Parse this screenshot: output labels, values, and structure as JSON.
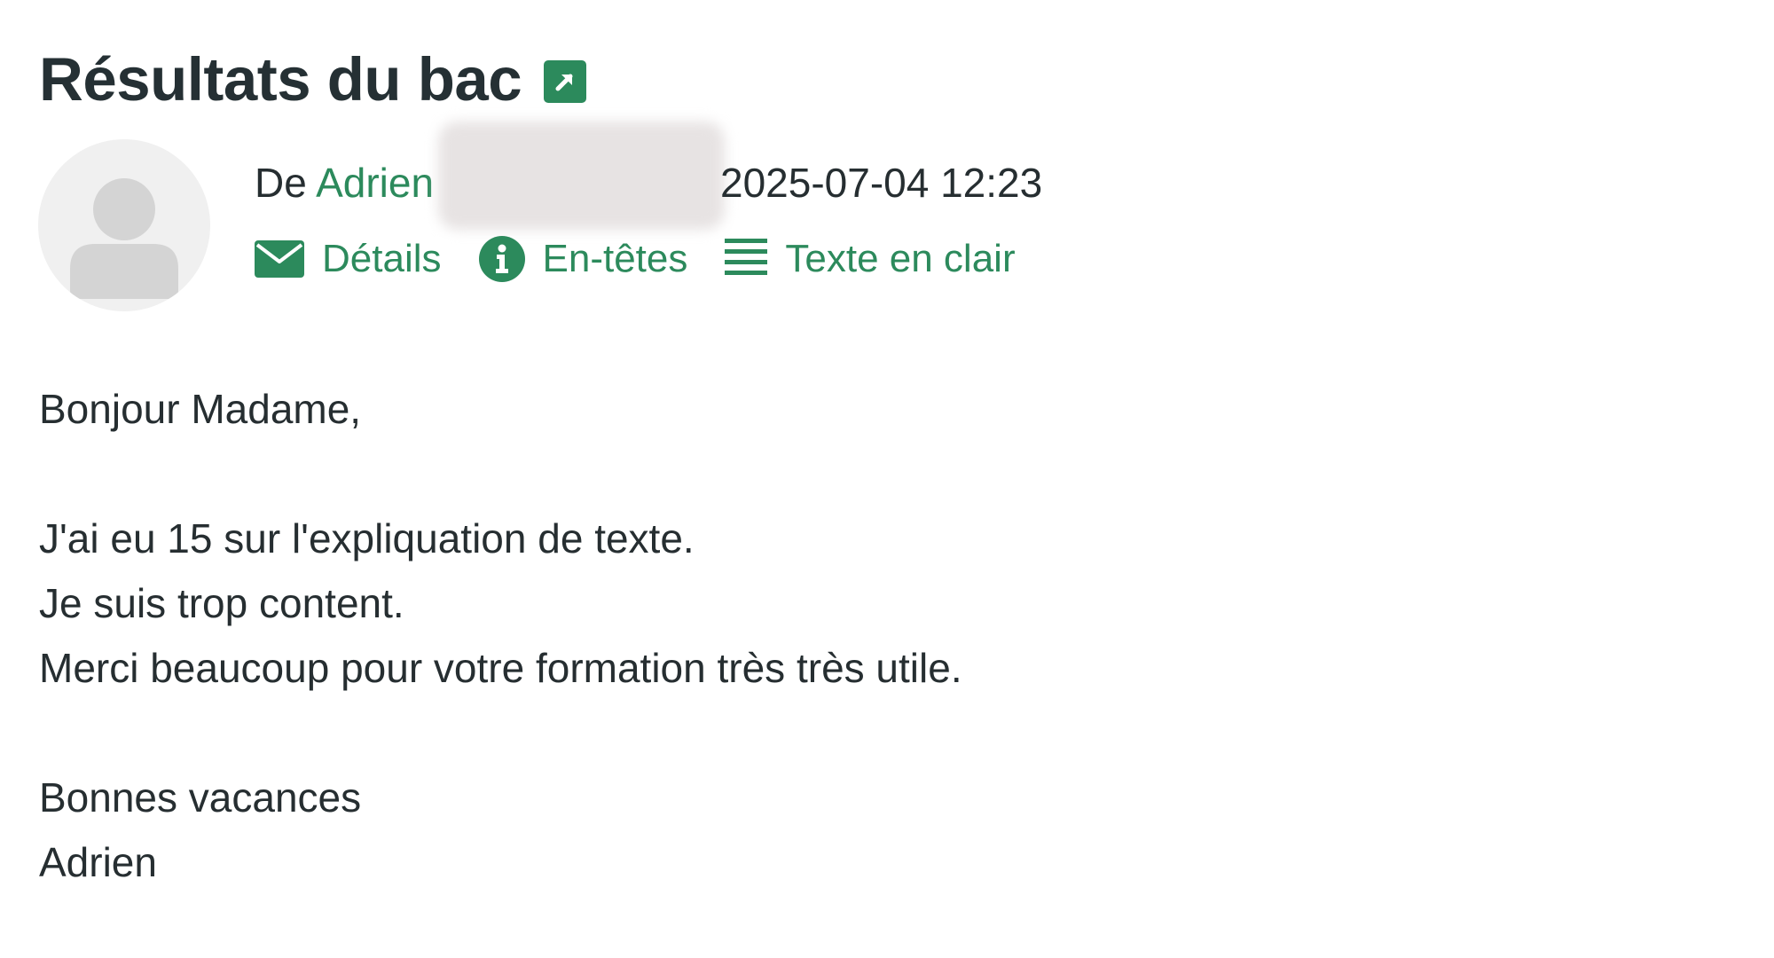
{
  "message": {
    "subject": "Résultats du bac",
    "from_prefix": "De",
    "from_name": "Adrien",
    "date": "2025-07-04 12:23",
    "actions": [
      {
        "label": "Détails",
        "icon": "envelope-icon"
      },
      {
        "label": "En-têtes",
        "icon": "info-icon"
      },
      {
        "label": "Texte en clair",
        "icon": "text-lines-icon"
      }
    ],
    "body": {
      "greeting": "Bonjour Madame,",
      "line1": "J'ai eu 15 sur l'expliquation de texte.",
      "line2": "Je suis trop content.",
      "line3": "Merci beaucoup pour votre formation très très utile.",
      "closing": "Bonnes vacances",
      "signature": "Adrien"
    }
  },
  "colors": {
    "accent": "#2c8a5c",
    "text": "#262e31",
    "avatar_bg": "#f0f0f0",
    "avatar_fg": "#d4d4d4"
  }
}
